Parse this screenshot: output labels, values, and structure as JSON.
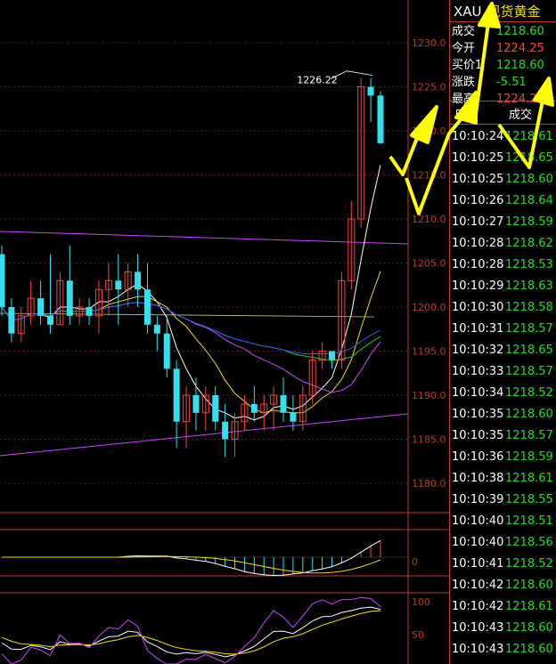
{
  "chart_data": {
    "type": "candlestick",
    "price_axis": {
      "min": 1180.0,
      "max": 1230.0,
      "ticks": [
        "1230.0",
        "1225.0",
        "1220.0",
        "1215.0",
        "1210.0",
        "1205.0",
        "1200.0",
        "1195.0",
        "1190.0",
        "1185.0",
        "1180.0"
      ]
    },
    "candles": [
      [
        1206,
        1207,
        1199,
        1200
      ],
      [
        1200,
        1201,
        1196,
        1197
      ],
      [
        1197,
        1200,
        1196,
        1199
      ],
      [
        1199,
        1203,
        1198,
        1201
      ],
      [
        1201,
        1203,
        1198,
        1199
      ],
      [
        1199,
        1206,
        1197,
        1198
      ],
      [
        1198,
        1204,
        1198,
        1203
      ],
      [
        1203,
        1207,
        1198,
        1199
      ],
      [
        1199,
        1201,
        1198,
        1200
      ],
      [
        1200,
        1201,
        1198,
        1199
      ],
      [
        1199,
        1203,
        1197,
        1202
      ],
      [
        1202,
        1205,
        1199,
        1203
      ],
      [
        1203,
        1206,
        1198,
        1202
      ],
      [
        1202,
        1205,
        1200,
        1204
      ],
      [
        1204,
        1206,
        1200,
        1202
      ],
      [
        1202,
        1205,
        1197,
        1198
      ],
      [
        1198,
        1199,
        1195,
        1197
      ],
      [
        1197,
        1199,
        1192,
        1193
      ],
      [
        1193,
        1194,
        1184,
        1187
      ],
      [
        1187,
        1191,
        1184,
        1190
      ],
      [
        1190,
        1192,
        1186,
        1188
      ],
      [
        1188,
        1191,
        1186,
        1190
      ],
      [
        1190,
        1191,
        1186,
        1187
      ],
      [
        1187,
        1189,
        1183,
        1185
      ],
      [
        1185,
        1188,
        1183,
        1187
      ],
      [
        1187,
        1190,
        1186,
        1189
      ],
      [
        1189,
        1191,
        1187,
        1188
      ],
      [
        1188,
        1190,
        1186,
        1189
      ],
      [
        1189,
        1191,
        1186,
        1190
      ],
      [
        1190,
        1192,
        1187,
        1188
      ],
      [
        1188,
        1190,
        1186,
        1187
      ],
      [
        1187,
        1191,
        1186,
        1190
      ],
      [
        1190,
        1195,
        1189,
        1194
      ],
      [
        1194,
        1196,
        1193,
        1195
      ],
      [
        1195,
        1195,
        1193,
        1194
      ],
      [
        1194,
        1204,
        1193,
        1203
      ],
      [
        1203,
        1212,
        1202,
        1210
      ],
      [
        1210,
        1226,
        1209,
        1225
      ],
      [
        1225,
        1226,
        1221,
        1224
      ],
      [
        1224,
        1224.5,
        1218.5,
        1218.6
      ]
    ],
    "annotations": {
      "high_label": "1226.22"
    },
    "macd_axis_label": "0",
    "kdj_axis_labels": [
      "100",
      "50"
    ]
  },
  "quote": {
    "symbol": "XAU",
    "name": "现货黄金",
    "rows": [
      {
        "label": "成交",
        "value": "1218.60",
        "color": "#22dd22"
      },
      {
        "label": "今开",
        "value": "1224.25",
        "color": "#ff4040"
      },
      {
        "label": "买价1",
        "value": "1218.60",
        "color": "#22dd22"
      },
      {
        "label": "涨跌",
        "value": "-5.51",
        "color": "#22dd22"
      },
      {
        "label": "最高",
        "value": "1224.25",
        "color": "#ff4040"
      }
    ]
  },
  "ticks_table": {
    "col_time": "时间",
    "col_price": "成交",
    "rows": [
      {
        "time": "10:10:24",
        "price": "1218.61"
      },
      {
        "time": "10:10:25",
        "price": "1218.65"
      },
      {
        "time": "10:10:25",
        "price": "1218.60"
      },
      {
        "time": "10:10:26",
        "price": "1218.64"
      },
      {
        "time": "10:10:27",
        "price": "1218.59"
      },
      {
        "time": "10:10:28",
        "price": "1218.62"
      },
      {
        "time": "10:10:28",
        "price": "1218.53"
      },
      {
        "time": "10:10:29",
        "price": "1218.63"
      },
      {
        "time": "10:10:30",
        "price": "1218.58"
      },
      {
        "time": "10:10:31",
        "price": "1218.57"
      },
      {
        "time": "10:10:32",
        "price": "1218.65"
      },
      {
        "time": "10:10:33",
        "price": "1218.57"
      },
      {
        "time": "10:10:34",
        "price": "1218.52"
      },
      {
        "time": "10:10:35",
        "price": "1218.60"
      },
      {
        "time": "10:10:35",
        "price": "1218.57"
      },
      {
        "time": "10:10:36",
        "price": "1218.59"
      },
      {
        "time": "10:10:38",
        "price": "1218.61"
      },
      {
        "time": "10:10:39",
        "price": "1218.55"
      },
      {
        "time": "10:10:40",
        "price": "1218.51"
      },
      {
        "time": "10:10:40",
        "price": "1218.56"
      },
      {
        "time": "10:10:41",
        "price": "1218.52"
      },
      {
        "time": "10:10:42",
        "price": "1218.60"
      },
      {
        "time": "10:10:42",
        "price": "1218.61"
      },
      {
        "time": "10:10:43",
        "price": "1218.60"
      },
      {
        "time": "10:10:43",
        "price": "1218.60"
      }
    ]
  },
  "colors": {
    "up": "#ff4040",
    "down": "#33e0f0",
    "grid": "#c0392b",
    "arrow": "#ffff00"
  }
}
